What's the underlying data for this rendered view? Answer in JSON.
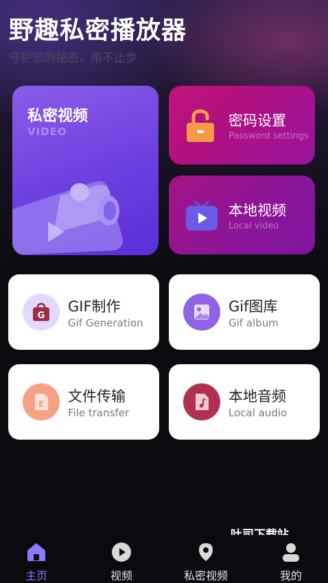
{
  "header": {
    "title": "野趣私密播放器",
    "subtitle": "守护您的秘密，用不止步"
  },
  "cards": {
    "private_video": {
      "title": "私密视频",
      "subtitle": "VIDEO"
    },
    "password": {
      "title": "密码设置",
      "subtitle": "Password settings"
    },
    "local_video": {
      "title": "本地视频",
      "subtitle": "Local video"
    },
    "gif_make": {
      "title": "GIF制作",
      "subtitle": "Gif Generation"
    },
    "gif_album": {
      "title": "Gif图库",
      "subtitle": "Gif album"
    },
    "file_transfer": {
      "title": "文件传输",
      "subtitle": "File transfer"
    },
    "local_audio": {
      "title": "本地音频",
      "subtitle": "Local audio"
    }
  },
  "watermark": "吐司下载站",
  "tabbar": {
    "items": [
      {
        "label": "主页",
        "icon": "home-icon",
        "active": true
      },
      {
        "label": "视频",
        "icon": "play-circle-icon",
        "active": false
      },
      {
        "label": "私密视频",
        "icon": "location-pin-icon",
        "active": false
      },
      {
        "label": "我的",
        "icon": "user-icon",
        "active": false
      }
    ]
  },
  "colors": {
    "active_tab": "#8d78ff",
    "private_card": "#6c3fe0",
    "password_card": "#b01080",
    "local_video_card": "#8e1595"
  }
}
